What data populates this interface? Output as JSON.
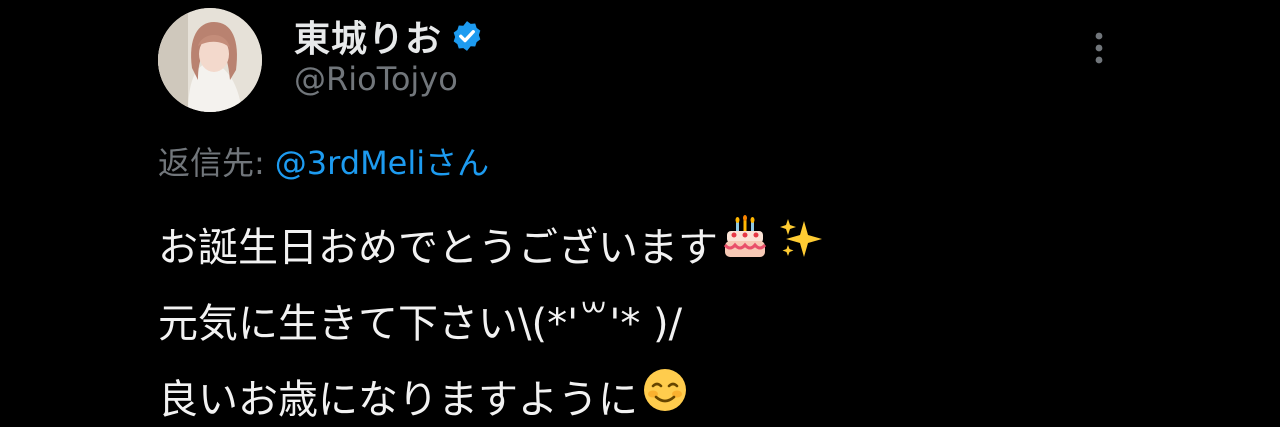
{
  "tweet": {
    "author": {
      "display_name": "東城りお",
      "handle": "@RioTojyo",
      "verified": true
    },
    "reply_to": {
      "prefix": "返信先:",
      "mention": "@3rdMeliさん"
    },
    "lines": [
      {
        "text": "お誕生日おめでとうございます",
        "emojis": [
          "birthday-cake-icon",
          "sparkles-icon"
        ]
      },
      {
        "text": "元気に生きて下さい\\(*'꒳'* )/",
        "emojis": []
      },
      {
        "text": "良いお歳になりますように",
        "emojis": [
          "smiling-face-icon"
        ]
      }
    ]
  },
  "colors": {
    "background": "#000000",
    "text_primary": "#e7e9ea",
    "text_secondary": "#71767b",
    "accent": "#1d9bf0"
  }
}
